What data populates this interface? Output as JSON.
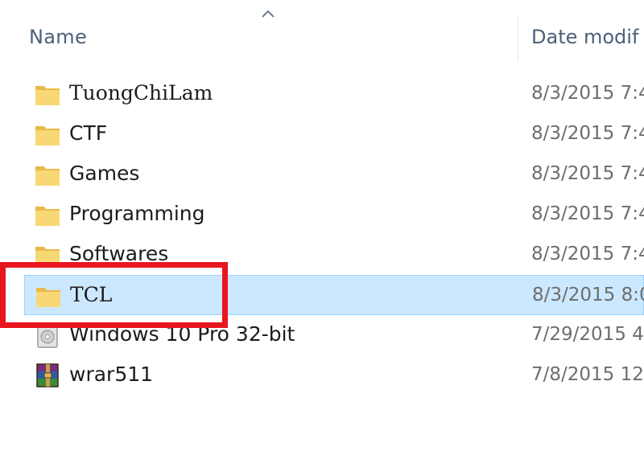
{
  "header": {
    "name_label": "Name",
    "date_label": "Date modif"
  },
  "files": [
    {
      "name": "TuongChiLam",
      "date": "8/3/2015 7:4",
      "icon": "folder-icon",
      "selected": false
    },
    {
      "name": "CTF",
      "date": "8/3/2015 7:4",
      "icon": "folder-icon",
      "selected": false
    },
    {
      "name": "Games",
      "date": "8/3/2015 7:4",
      "icon": "folder-icon",
      "selected": false
    },
    {
      "name": "Programming",
      "date": "8/3/2015 7:4",
      "icon": "folder-icon",
      "selected": false
    },
    {
      "name": "Softwares",
      "date": "8/3/2015 7:4",
      "icon": "folder-icon",
      "selected": false
    },
    {
      "name": "TCL",
      "date": "8/3/2015 8:0",
      "icon": "folder-icon",
      "selected": true
    },
    {
      "name": "Windows 10 Pro 32-bit",
      "date": "7/29/2015 4",
      "icon": "disc-image-icon",
      "selected": false
    },
    {
      "name": "wrar511",
      "date": "7/8/2015 12",
      "icon": "winrar-icon",
      "selected": false
    }
  ],
  "colors": {
    "folder": "#f8d775",
    "selection_bg": "#cce8ff",
    "selection_border": "#99d1ff",
    "annotation": "#e8161f"
  }
}
